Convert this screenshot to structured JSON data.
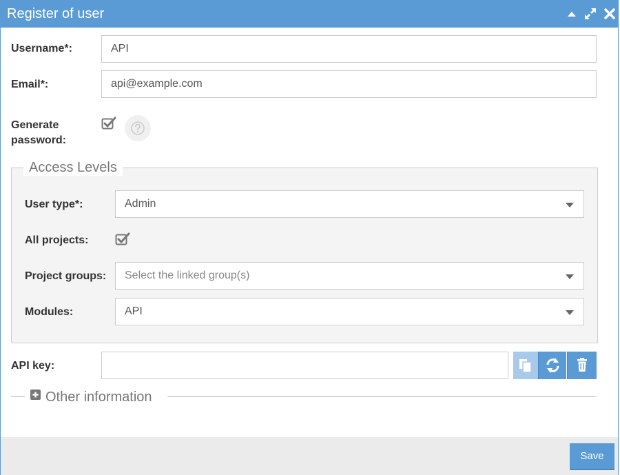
{
  "window": {
    "title": "Register of user",
    "controls": [
      "collapse-icon",
      "expand-icon",
      "close-icon"
    ]
  },
  "form": {
    "username": {
      "label": "Username*:",
      "value": "API"
    },
    "email": {
      "label": "Email*:",
      "value": "api@example.com"
    },
    "generate_password": {
      "label_line1": "Generate",
      "label_line2": "password:",
      "checked": true
    },
    "help_icon": "question-circle-icon",
    "api_key": {
      "label": "API key:",
      "value": ""
    }
  },
  "access_levels": {
    "legend": "Access Levels",
    "user_type": {
      "label": "User type*:",
      "value": "Admin"
    },
    "all_projects": {
      "label": "All projects:",
      "checked": true
    },
    "project_groups": {
      "label": "Project groups:",
      "placeholder": "Select the linked group(s)"
    },
    "modules": {
      "label": "Modules:",
      "value": "API"
    }
  },
  "api_key_buttons": [
    "copy-icon",
    "refresh-icon",
    "trash-icon"
  ],
  "other_information": {
    "label": "Other information",
    "icon": "plus-square-icon"
  },
  "footer": {
    "save_label": "Save"
  },
  "colors": {
    "accent": "#5b9bd5",
    "accent_light": "#a9c9ea",
    "footer_bg": "#ebebeb",
    "fieldset_bg": "#f4f4f4"
  }
}
